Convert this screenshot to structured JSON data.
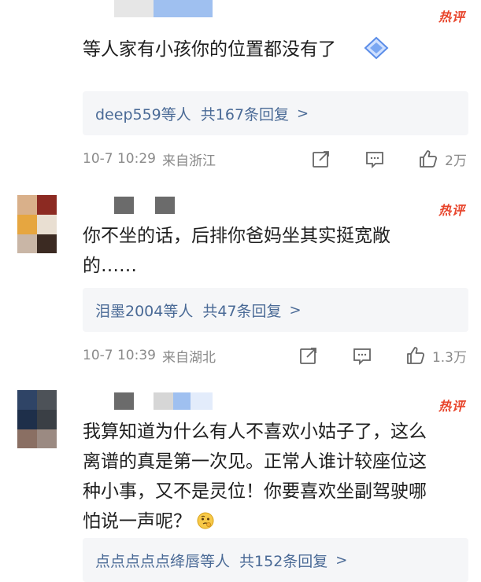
{
  "comments": [
    {
      "hot_label": "热评",
      "text": "等人家有小孩你的位置都没有了",
      "replies": {
        "lead": "deep559等人",
        "count": "共167条回复"
      },
      "time": "10-7 10:29",
      "location": "来自浙江",
      "likes": "2万"
    },
    {
      "hot_label": "热评",
      "text_line1": "你不坐的话，后排你爸妈坐其实挺宽敞",
      "text_line2": "的……",
      "replies": {
        "lead": "泪墨2004等人",
        "count": "共47条回复"
      },
      "time": "10-7 10:39",
      "location": "来自湖北",
      "likes": "1.3万"
    },
    {
      "hot_label": "热评",
      "text_line1": "我算知道为什么有人不喜欢小姑子了，这么",
      "text_line2": "离谱的真是第一次见。正常人谁计较座位这",
      "text_line3": "种小事，又不是灵位！你要喜欢坐副驾驶哪",
      "text_line4": "怕说一声呢？",
      "replies": {
        "lead": "点点点点点绛唇等人",
        "count": "共152条回复"
      }
    }
  ],
  "colors": {
    "hot": "#e8452c",
    "link": "#4a6a96",
    "meta": "#8a8a8a"
  }
}
